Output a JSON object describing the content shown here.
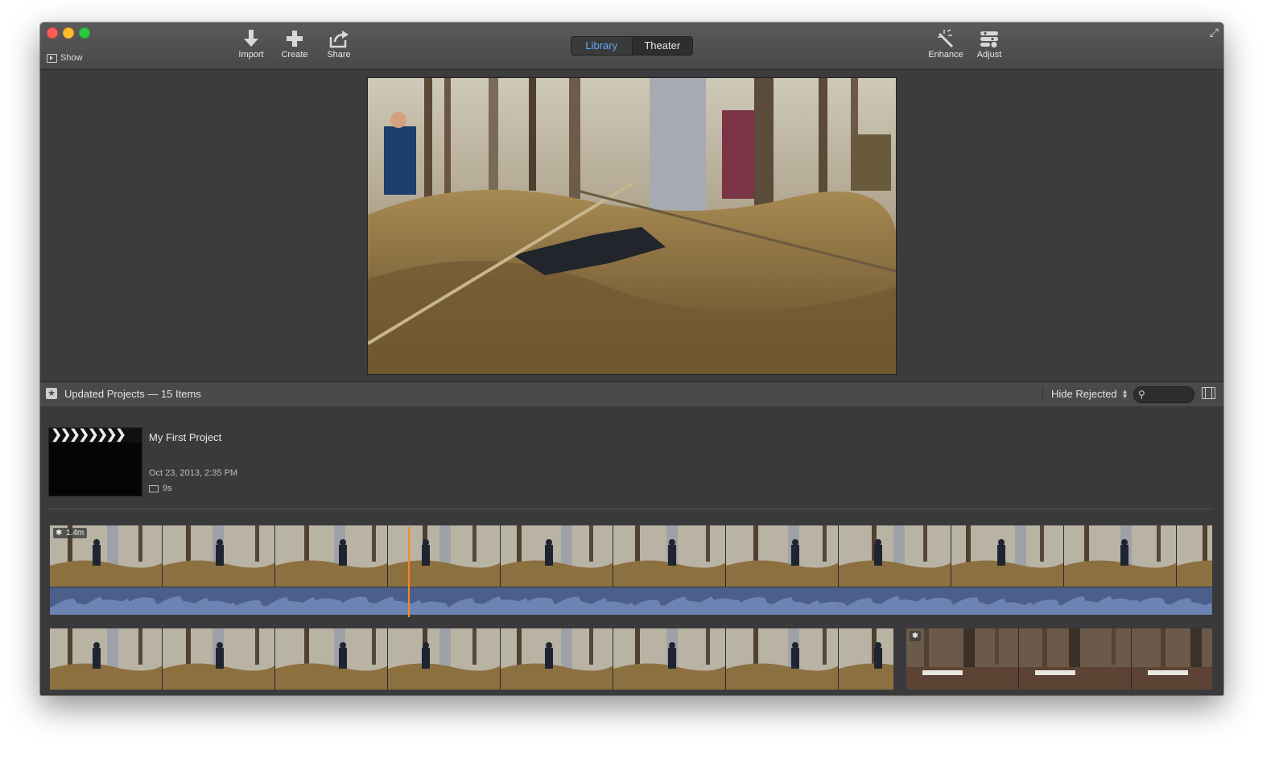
{
  "toolbar": {
    "show_label": "Show",
    "import_label": "Import",
    "create_label": "Create",
    "share_label": "Share",
    "library_tab": "Library",
    "theater_tab": "Theater",
    "enhance_label": "Enhance",
    "adjust_label": "Adjust",
    "fullscreen_icon": "expand-arrows-icon"
  },
  "browser": {
    "title": "Updated Projects — 15 Items",
    "filter_label": "Hide Rejected",
    "search_placeholder": ""
  },
  "project": {
    "name": "My First Project",
    "date": "Oct 23, 2013, 2:35 PM",
    "duration": "9s"
  },
  "clips": {
    "row1_badge": "1.4m",
    "row1_playhead_fraction": 0.308
  },
  "colors": {
    "accent_tab": "#62a8f5",
    "playhead": "#f08a24",
    "audio_wave": "#4b5f8a"
  }
}
